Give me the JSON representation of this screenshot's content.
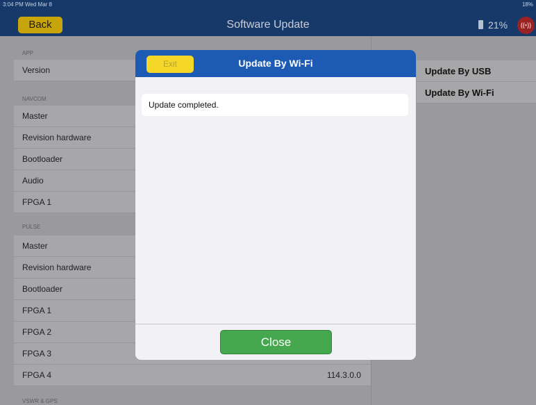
{
  "status_bar": {
    "time": "3:04 PM  Wed Mar 8",
    "right": "18%"
  },
  "nav": {
    "back_label": "Back",
    "title": "Software Update",
    "battery": "21%",
    "radio_icon": "((•))"
  },
  "left_list": {
    "app_header": "APP",
    "app_rows": [
      "Version"
    ],
    "navcom_header": "NAVCOM",
    "navcom_rows": [
      "Master",
      "Revision hardware",
      "Bootloader",
      "Audio",
      "FPGA 1"
    ],
    "pulse_header": "PULSE",
    "pulse_rows": [
      "Master",
      "Revision hardware",
      "Bootloader",
      "FPGA 1",
      "FPGA 2",
      "FPGA 3",
      "FPGA 4"
    ],
    "fpga4_value": "114.3.0.0",
    "vswr_header": "VSWR & GPS"
  },
  "right_list": [
    "Update By USB",
    "Update By Wi-Fi"
  ],
  "modal": {
    "exit_label": "Exit",
    "title": "Update By Wi-Fi",
    "message": "Update completed.",
    "close_label": "Close"
  },
  "colors": {
    "nav_bg": "#17396a",
    "modal_header": "#1c5ab4",
    "close_button": "#46a84e",
    "exit_button": "#f5d729"
  }
}
